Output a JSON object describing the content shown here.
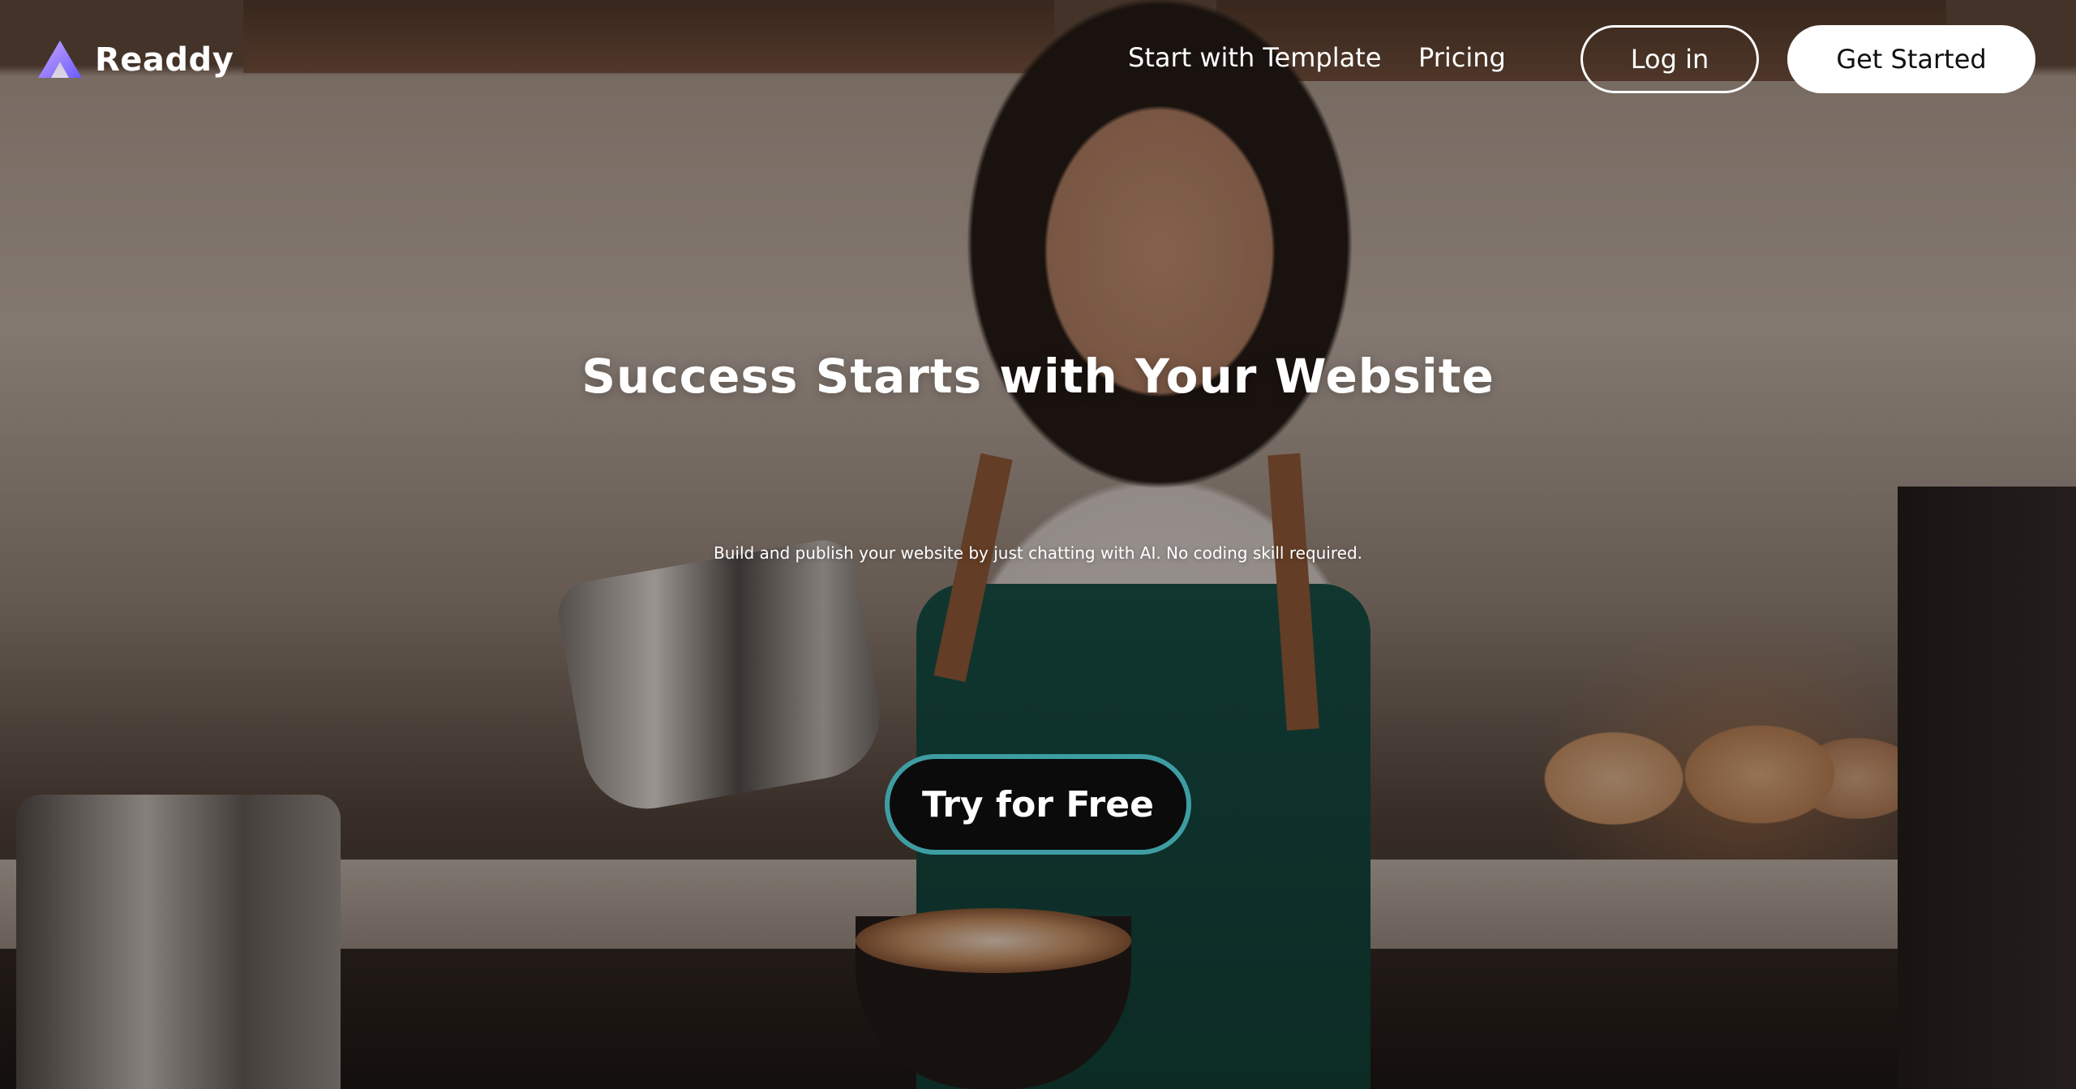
{
  "brand": {
    "name": "Readdy",
    "logo_icon": "readdy-logo-icon",
    "logo_colors": [
      "#b388ff",
      "#6a5cff"
    ]
  },
  "nav": {
    "links": [
      {
        "label": "Start with Template"
      },
      {
        "label": "Pricing"
      }
    ],
    "login_label": "Log in",
    "get_started_label": "Get Started"
  },
  "hero": {
    "headline": "Success Starts with Your Website",
    "subheadline": "Build and publish your website by just chatting with AI. No coding skill required.",
    "cta_label": "Try for Free",
    "cta_border_color": "#3e9da2",
    "background_image": "barista-pouring-latte-photo"
  }
}
